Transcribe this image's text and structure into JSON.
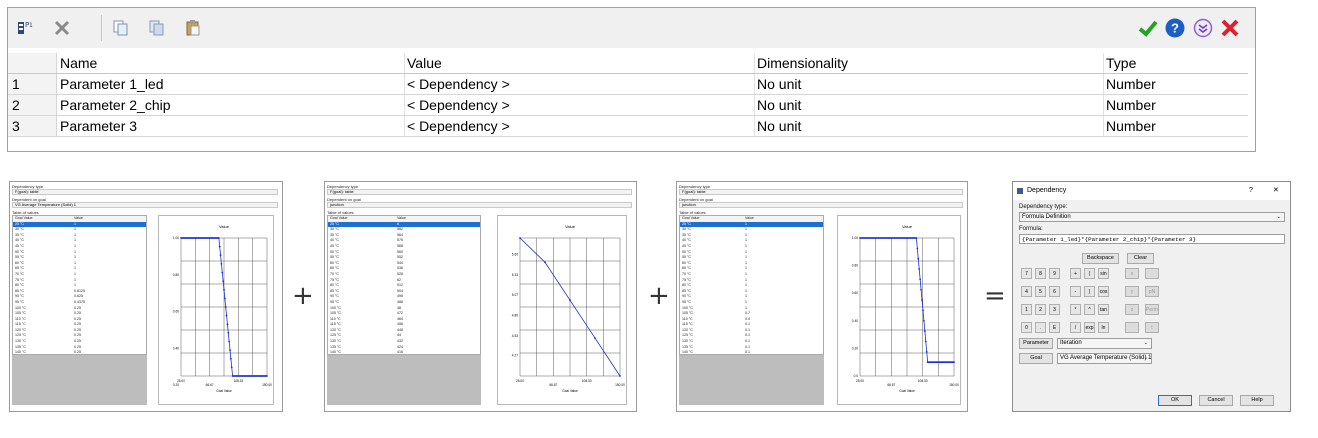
{
  "toolbar": {
    "icons": [
      "parameter-add-icon",
      "delete-icon",
      "copy-icon",
      "paste-icon",
      "paste-special-icon",
      "accept-icon",
      "help-icon",
      "options-icon",
      "close-icon"
    ],
    "accent_ok": "#22a322",
    "accent_help": "#1b5fc2",
    "accent_close": "#e0202a"
  },
  "grid": {
    "columns": [
      "Name",
      "Value",
      "Dimensionality",
      "Type"
    ],
    "rows": [
      {
        "num": "1",
        "name": "Parameter 1_led",
        "value": "< Dependency >",
        "dim": "No unit",
        "type": "Number"
      },
      {
        "num": "2",
        "name": "Parameter 2_chip",
        "value": "< Dependency >",
        "dim": "No unit",
        "type": "Number"
      },
      {
        "num": "3",
        "name": "Parameter 3",
        "value": "< Dependency >",
        "dim": "No unit",
        "type": "Number"
      }
    ]
  },
  "thumb1": {
    "dep_type_label": "Dependency type",
    "dep_type": "F(goal): table",
    "dep_goal_label": "Dependent on goal",
    "dep_goal": "VG Average Temperature (Solid) 1",
    "table_label": "Table of values",
    "col_goal": "Goal Value",
    "col_value": "Value",
    "rows": [
      [
        "25 °C",
        "1"
      ],
      [
        "30 °C",
        "1"
      ],
      [
        "35 °C",
        "1"
      ],
      [
        "40 °C",
        "1"
      ],
      [
        "45 °C",
        "1"
      ],
      [
        "50 °C",
        "1"
      ],
      [
        "55 °C",
        "1"
      ],
      [
        "60 °C",
        "1"
      ],
      [
        "65 °C",
        "1"
      ],
      [
        "70 °C",
        "1"
      ],
      [
        "75 °C",
        "1"
      ],
      [
        "80 °C",
        "1"
      ],
      [
        "85 °C",
        "0.8125"
      ],
      [
        "90 °C",
        "0.625"
      ],
      [
        "95 °C",
        "0.4375"
      ],
      [
        "100 °C",
        "0.25"
      ],
      [
        "105 °C",
        "0.25"
      ],
      [
        "110 °C",
        "0.25"
      ],
      [
        "115 °C",
        "0.25"
      ],
      [
        "120 °C",
        "0.25"
      ],
      [
        "125 °C",
        "0.25"
      ],
      [
        "130 °C",
        "0.25"
      ],
      [
        "135 °C",
        "0.25"
      ],
      [
        "140 °C",
        "0.25"
      ],
      [
        "145 °C",
        "0.25"
      ],
      [
        "150 °C",
        "0.25"
      ]
    ],
    "chart_title": "Value",
    "y_ticks": [
      "1.00",
      "0.80",
      "0.60",
      "0.40",
      "0.20"
    ],
    "x_ticks": [
      "25.00",
      "66.67",
      "108.33",
      "150.00"
    ],
    "xlabel": "Goal Value"
  },
  "thumb2": {
    "dep_type_label": "Dependency type",
    "dep_type": "F(goal): table",
    "dep_goal_label": "Dependent on goal",
    "dep_goal": "junction",
    "table_label": "Table of values",
    "col_goal": "Goal Value",
    "col_value": "Value",
    "rows": [
      [
        "25 °C",
        "6"
      ],
      [
        "30 °C",
        "582"
      ],
      [
        "35 °C",
        "564"
      ],
      [
        "40 °C",
        "576"
      ],
      [
        "45 °C",
        "568"
      ],
      [
        "50 °C",
        "560"
      ],
      [
        "55 °C",
        "552"
      ],
      [
        "60 °C",
        "544"
      ],
      [
        "65 °C",
        "536"
      ],
      [
        "70 °C",
        "528"
      ],
      [
        "75 °C",
        "62"
      ],
      [
        "80 °C",
        "512"
      ],
      [
        "85 °C",
        "504"
      ],
      [
        "90 °C",
        "496"
      ],
      [
        "95 °C",
        "488"
      ],
      [
        "100 °C",
        "48"
      ],
      [
        "105 °C",
        "472"
      ],
      [
        "110 °C",
        "464"
      ],
      [
        "115 °C",
        "456"
      ],
      [
        "120 °C",
        "448"
      ],
      [
        "125 °C",
        "44"
      ],
      [
        "130 °C",
        "432"
      ],
      [
        "135 °C",
        "424"
      ],
      [
        "140 °C",
        "416"
      ],
      [
        "145 °C",
        "408"
      ],
      [
        "150 °C",
        "4"
      ]
    ],
    "chart_title": "Value",
    "y_ticks": [
      "5.60",
      "5.33",
      "5.07",
      "4.80",
      "4.53",
      "4.27"
    ],
    "x_ticks": [
      "25.00",
      "66.67",
      "108.33",
      "150.00"
    ],
    "xlabel": "Goal Value"
  },
  "thumb3": {
    "dep_type_label": "Dependency type",
    "dep_type": "F(goal): table",
    "dep_goal_label": "Dependent on goal",
    "dep_goal": "junction",
    "table_label": "Table of values",
    "col_goal": "Goal Value",
    "col_value": "Value",
    "rows": [
      [
        "25 °C",
        "1"
      ],
      [
        "30 °C",
        "1"
      ],
      [
        "35 °C",
        "1"
      ],
      [
        "40 °C",
        "1"
      ],
      [
        "45 °C",
        "1"
      ],
      [
        "50 °C",
        "1"
      ],
      [
        "55 °C",
        "1"
      ],
      [
        "60 °C",
        "1"
      ],
      [
        "65 °C",
        "1"
      ],
      [
        "70 °C",
        "1"
      ],
      [
        "75 °C",
        "1"
      ],
      [
        "80 °C",
        "1"
      ],
      [
        "85 °C",
        "1"
      ],
      [
        "90 °C",
        "1"
      ],
      [
        "95 °C",
        "1"
      ],
      [
        "100 °C",
        "1"
      ],
      [
        "105 °C",
        "0.7"
      ],
      [
        "110 °C",
        "0.4"
      ],
      [
        "115 °C",
        "0.1"
      ],
      [
        "120 °C",
        "0.1"
      ],
      [
        "125 °C",
        "0.1"
      ],
      [
        "130 °C",
        "0.1"
      ],
      [
        "135 °C",
        "0.1"
      ],
      [
        "140 °C",
        "0.1"
      ],
      [
        "145 °C",
        "0.1"
      ],
      [
        "150 °C",
        "0.1"
      ]
    ],
    "chart_title": "Value",
    "y_ticks": [
      "1.00",
      "0.80",
      "0.60",
      "0.40",
      "0.20",
      "0.0"
    ],
    "x_ticks": [
      "25.00",
      "66.67",
      "108.33",
      "150.00"
    ],
    "xlabel": "Goal Value"
  },
  "operators": {
    "plus1": "+",
    "plus2": "+",
    "equals": "="
  },
  "dialog": {
    "title": "Dependency",
    "help_glyph": "?",
    "close_glyph": "✕",
    "dep_type_label": "Dependency type:",
    "dep_type": "Formula Definition",
    "formula_label": "Formula:",
    "formula": "{Parameter 1_led}*{Parameter 2_chip}*{Parameter 3}",
    "backspace": "Backspace",
    "clear": "Clear",
    "keys_num": [
      "7",
      "8",
      "9",
      "4",
      "5",
      "6",
      "1",
      "2",
      "3",
      "0",
      ".",
      "E"
    ],
    "keys_op": [
      "+",
      "(",
      "sin",
      "-",
      ")",
      "cos",
      "*",
      "^",
      "tan",
      "/",
      "exp",
      "ln"
    ],
    "keys_dis": [
      "x",
      "",
      "y",
      "pN",
      "z",
      "Perm",
      "",
      "t"
    ],
    "parameter_btn": "Parameter",
    "parameter_value": "Iteration",
    "goal_btn": "Goal",
    "goal_value": "VG Average Temperature (Solid) 1",
    "ok": "OK",
    "cancel": "Cancel",
    "help": "Help"
  }
}
